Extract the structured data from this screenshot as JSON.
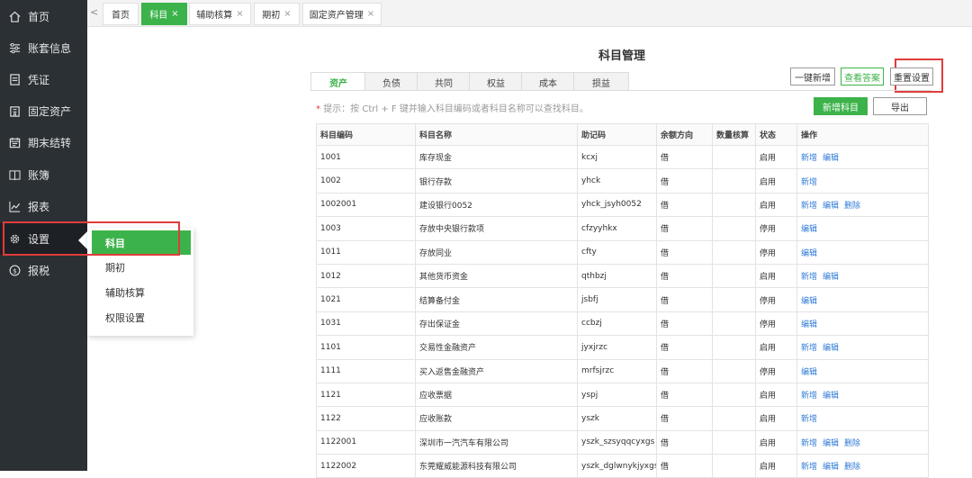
{
  "sidebar": {
    "items": [
      {
        "label": "首页",
        "icon": "home-icon"
      },
      {
        "label": "账套信息",
        "icon": "sliders-icon"
      },
      {
        "label": "凭证",
        "icon": "document-icon"
      },
      {
        "label": "固定资产",
        "icon": "building-icon"
      },
      {
        "label": "期末结转",
        "icon": "calendar-icon"
      },
      {
        "label": "账簿",
        "icon": "book-icon"
      },
      {
        "label": "报表",
        "icon": "line-chart-icon"
      },
      {
        "label": "设置",
        "icon": "gear-icon"
      },
      {
        "label": "报税",
        "icon": "tax-coin-icon"
      }
    ],
    "active": "设置"
  },
  "flyout": {
    "items": [
      "科目",
      "期初",
      "辅助核算",
      "权限设置"
    ],
    "active": "科目"
  },
  "tabbar": {
    "prev": "<",
    "tabs": [
      {
        "label": "首页",
        "closable": false
      },
      {
        "label": "科目",
        "closable": true,
        "active": true
      },
      {
        "label": "辅助核算",
        "closable": true
      },
      {
        "label": "期初",
        "closable": true
      },
      {
        "label": "固定资产管理",
        "closable": true
      }
    ],
    "close_glyph": "×"
  },
  "page": {
    "title": "科目管理",
    "type_tabs": [
      "资产",
      "负债",
      "共同",
      "权益",
      "成本",
      "损益"
    ],
    "active_type_tab": "资产",
    "buttons": {
      "one_click_add": "一键新增",
      "view_archive": "查看答案",
      "reset_settings": "重置设置",
      "add_subject": "新增科目",
      "export": "导出"
    },
    "hint_star": "*",
    "hint": "提示：按 Ctrl + F 键并输入科目编码或者科目名称可以查找科目。"
  },
  "table": {
    "headers": [
      "科目编码",
      "科目名称",
      "助记码",
      "余额方向",
      "数量核算",
      "状态",
      "操作"
    ],
    "rows": [
      {
        "code": "1001",
        "name": "库存现金",
        "mnemonic": "kcxj",
        "direction": "借",
        "qty": "",
        "status": "启用",
        "ops": [
          "新增",
          "编辑"
        ],
        "level": 1
      },
      {
        "code": "1002",
        "name": "银行存款",
        "mnemonic": "yhck",
        "direction": "借",
        "qty": "",
        "status": "启用",
        "ops": [
          "新增"
        ],
        "level": 1
      },
      {
        "code": "1002001",
        "name": "建设银行0052",
        "mnemonic": "yhck_jsyh0052",
        "direction": "借",
        "qty": "",
        "status": "启用",
        "ops": [
          "新增",
          "编辑",
          "删除"
        ],
        "level": 2
      },
      {
        "code": "1003",
        "name": "存放中央银行款项",
        "mnemonic": "cfzyyhkx",
        "direction": "借",
        "qty": "",
        "status": "停用",
        "ops": [
          "编辑"
        ],
        "level": 1
      },
      {
        "code": "1011",
        "name": "存放同业",
        "mnemonic": "cfty",
        "direction": "借",
        "qty": "",
        "status": "停用",
        "ops": [
          "编辑"
        ],
        "level": 1
      },
      {
        "code": "1012",
        "name": "其他货币资金",
        "mnemonic": "qthbzj",
        "direction": "借",
        "qty": "",
        "status": "启用",
        "ops": [
          "新增",
          "编辑"
        ],
        "level": 1
      },
      {
        "code": "1021",
        "name": "结算备付金",
        "mnemonic": "jsbfj",
        "direction": "借",
        "qty": "",
        "status": "停用",
        "ops": [
          "编辑"
        ],
        "level": 1
      },
      {
        "code": "1031",
        "name": "存出保证金",
        "mnemonic": "ccbzj",
        "direction": "借",
        "qty": "",
        "status": "停用",
        "ops": [
          "编辑"
        ],
        "level": 1
      },
      {
        "code": "1101",
        "name": "交易性金融资产",
        "mnemonic": "jyxjrzc",
        "direction": "借",
        "qty": "",
        "status": "启用",
        "ops": [
          "新增",
          "编辑"
        ],
        "level": 1
      },
      {
        "code": "1111",
        "name": "买入返售金融资产",
        "mnemonic": "mrfsjrzc",
        "direction": "借",
        "qty": "",
        "status": "停用",
        "ops": [
          "编辑"
        ],
        "level": 1
      },
      {
        "code": "1121",
        "name": "应收票据",
        "mnemonic": "yspj",
        "direction": "借",
        "qty": "",
        "status": "启用",
        "ops": [
          "新增",
          "编辑"
        ],
        "level": 1
      },
      {
        "code": "1122",
        "name": "应收账款",
        "mnemonic": "yszk",
        "direction": "借",
        "qty": "",
        "status": "启用",
        "ops": [
          "新增"
        ],
        "level": 1
      },
      {
        "code": "1122001",
        "name": "深圳市一汽汽车有限公司",
        "mnemonic": "yszk_szsyqqcyxgs",
        "direction": "借",
        "qty": "",
        "status": "启用",
        "ops": [
          "新增",
          "编辑",
          "删除"
        ],
        "level": 2
      },
      {
        "code": "1122002",
        "name": "东莞耀威能源科技有限公司",
        "mnemonic": "yszk_dglwnykjyxgs",
        "direction": "借",
        "qty": "",
        "status": "启用",
        "ops": [
          "新增",
          "编辑",
          "删除"
        ],
        "level": 2
      }
    ]
  },
  "colors": {
    "sidebar_bg": "#2b3035",
    "accent_green": "#3cb34a",
    "link_blue": "#2f7ad6",
    "highlight_red": "#e03c3c"
  }
}
